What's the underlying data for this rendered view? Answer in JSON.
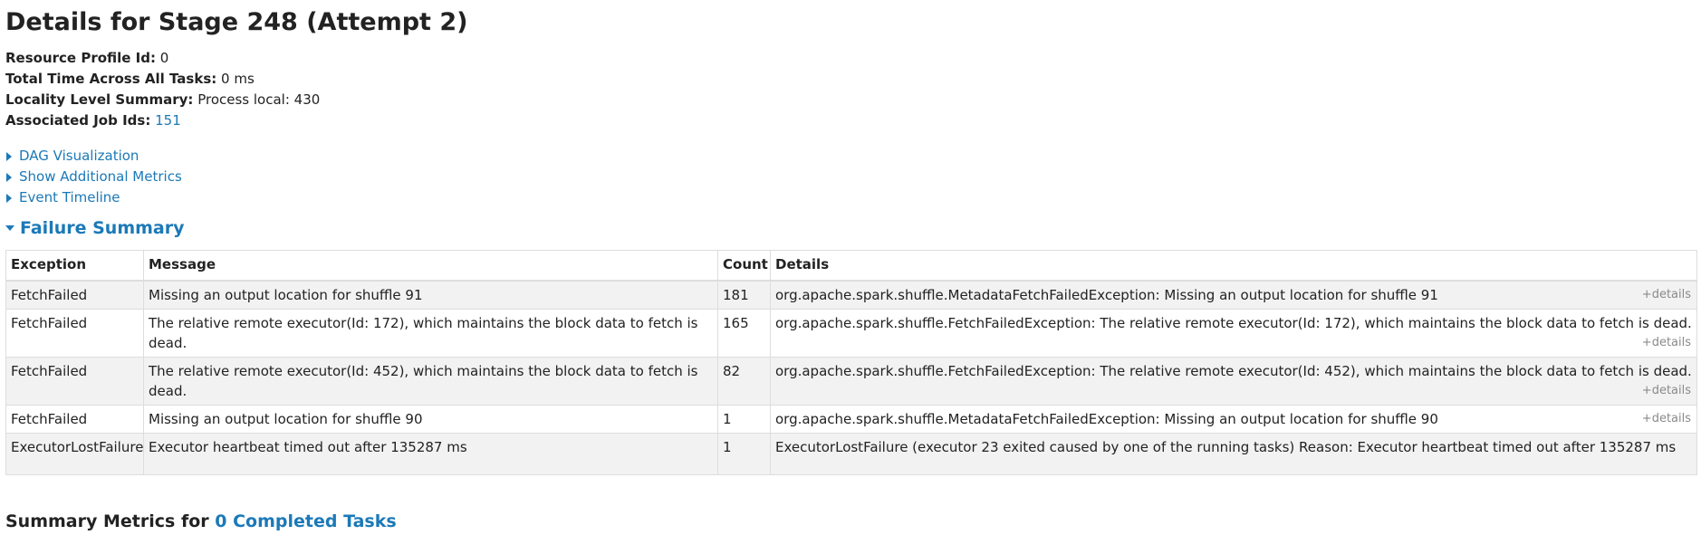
{
  "page": {
    "title": "Details for Stage 248 (Attempt 2)"
  },
  "info": [
    {
      "label": "Resource Profile Id:",
      "value": "0"
    },
    {
      "label": "Total Time Across All Tasks:",
      "value": "0 ms"
    },
    {
      "label": "Locality Level Summary:",
      "value": "Process local: 430"
    },
    {
      "label": "Associated Job Ids:",
      "value": "151"
    }
  ],
  "toggles": [
    {
      "label": "DAG Visualization"
    },
    {
      "label": "Show Additional Metrics"
    },
    {
      "label": "Event Timeline"
    }
  ],
  "failure_summary": {
    "title": "Failure Summary",
    "columns": [
      "Exception",
      "Message",
      "Count",
      "Details"
    ],
    "rows": [
      {
        "exception": "FetchFailed",
        "message": "Missing an output location for shuffle 91",
        "count": "181",
        "details": "org.apache.spark.shuffle.MetadataFetchFailedException: Missing an output location for shuffle 91",
        "more": "+details"
      },
      {
        "exception": "FetchFailed",
        "message": "The relative remote executor(Id: 172), which maintains the block data to fetch is dead.",
        "count": "165",
        "details": "org.apache.spark.shuffle.FetchFailedException: The relative remote executor(Id: 172), which maintains the block data to fetch is dead.",
        "more": "+details"
      },
      {
        "exception": "FetchFailed",
        "message": "The relative remote executor(Id: 452), which maintains the block data to fetch is dead.",
        "count": "82",
        "details": "org.apache.spark.shuffle.FetchFailedException: The relative remote executor(Id: 452), which maintains the block data to fetch is dead.",
        "more": "+details"
      },
      {
        "exception": "FetchFailed",
        "message": "Missing an output location for shuffle 90",
        "count": "1",
        "details": "org.apache.spark.shuffle.MetadataFetchFailedException: Missing an output location for shuffle 90",
        "more": "+details"
      },
      {
        "exception": "ExecutorLostFailure",
        "message": "Executor heartbeat timed out after 135287 ms",
        "count": "1",
        "details": "ExecutorLostFailure (executor 23 exited caused by one of the running tasks) Reason: Executor heartbeat timed out after 135287 ms",
        "more": ""
      }
    ]
  },
  "summary_metrics": {
    "prefix": "Summary Metrics for",
    "link": "0 Completed Tasks"
  },
  "colors": {
    "link": "#1b79b8",
    "row_alt": "#f2f2f2",
    "border": "#dddddd"
  }
}
